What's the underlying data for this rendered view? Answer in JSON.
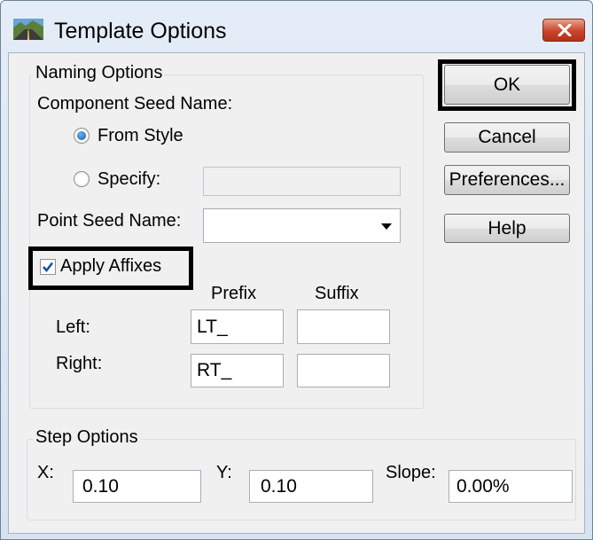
{
  "window": {
    "title": "Template Options"
  },
  "naming": {
    "legend": "Naming Options",
    "component_seed_label": "Component Seed Name:",
    "from_style_label": "From Style",
    "from_style_selected": true,
    "specify_label": "Specify:",
    "specify_value": "",
    "point_seed_label": "Point Seed Name:",
    "point_seed_value": "",
    "apply_affixes_label": "Apply Affixes",
    "apply_affixes_checked": true,
    "prefix_header": "Prefix",
    "suffix_header": "Suffix",
    "left_label": "Left:",
    "left_prefix": "LT_",
    "left_suffix": "",
    "right_label": "Right:",
    "right_prefix": "RT_",
    "right_suffix": ""
  },
  "step": {
    "legend": "Step Options",
    "x_label": "X:",
    "x_value": "0.10",
    "y_label": "Y:",
    "y_value": "0.10",
    "slope_label": "Slope:",
    "slope_value": "0.00%"
  },
  "buttons": {
    "ok": "OK",
    "cancel": "Cancel",
    "preferences": "Preferences...",
    "help": "Help"
  },
  "icons": {
    "app": "road-template-icon",
    "close": "close-icon",
    "dropdown": "chevron-down-icon"
  },
  "colors": {
    "close_button": "#c8442b",
    "radio_dot": "#0f58a8",
    "check_mark": "#1c4f9c",
    "highlight_box": "#000000"
  }
}
